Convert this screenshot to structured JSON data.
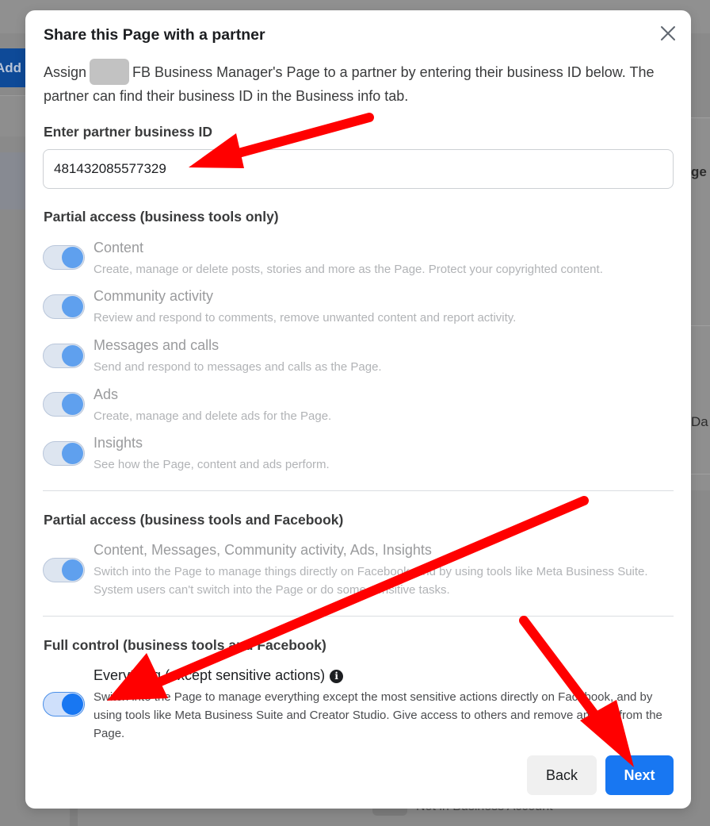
{
  "background": {
    "add_button_label": "Add",
    "right_text_1": "ge",
    "right_text_2": "Da",
    "bottom_text": "Not in Business Account"
  },
  "modal": {
    "title": "Share this Page with a partner",
    "close_icon": "close-icon",
    "intro_prefix": "Assign",
    "intro_suffix": "FB Business Manager's Page to a partner by entering their business ID below. The partner can find their business ID in the Business info tab.",
    "partner_id": {
      "label": "Enter partner business ID",
      "value": "481432085577329"
    },
    "sections": [
      {
        "title": "Partial access (business tools only)",
        "permissions": [
          {
            "title": "Content",
            "description": "Create, manage or delete posts, stories and more as the Page. Protect your copyrighted content.",
            "enabled": true
          },
          {
            "title": "Community activity",
            "description": "Review and respond to comments, remove unwanted content and report activity.",
            "enabled": true
          },
          {
            "title": "Messages and calls",
            "description": "Send and respond to messages and calls as the Page.",
            "enabled": true
          },
          {
            "title": "Ads",
            "description": "Create, manage and delete ads for the Page.",
            "enabled": true
          },
          {
            "title": "Insights",
            "description": "See how the Page, content and ads perform.",
            "enabled": true
          }
        ]
      },
      {
        "title": "Partial access (business tools and Facebook)",
        "permissions": [
          {
            "title": "Content, Messages, Community activity, Ads, Insights",
            "description": "Switch into the Page to manage things directly on Facebook, and by using tools like Meta Business Suite. System users can't switch into the Page or do some sensitive tasks.",
            "enabled": true
          }
        ]
      },
      {
        "title": "Full control (business tools and Facebook)",
        "permissions": [
          {
            "title": "Everything (except sensitive actions)",
            "description": "Switch into the Page to manage everything except the most sensitive actions directly on Facebook, and by using tools like Meta Business Suite and Creator Studio. Give access to others and remove anyone from the Page.",
            "enabled": true,
            "info_icon": "info-icon"
          }
        ]
      }
    ],
    "buttons": {
      "back": "Back",
      "next": "Next"
    }
  },
  "colors": {
    "primary": "#1877f2",
    "annotation_arrow": "#ff0000"
  }
}
